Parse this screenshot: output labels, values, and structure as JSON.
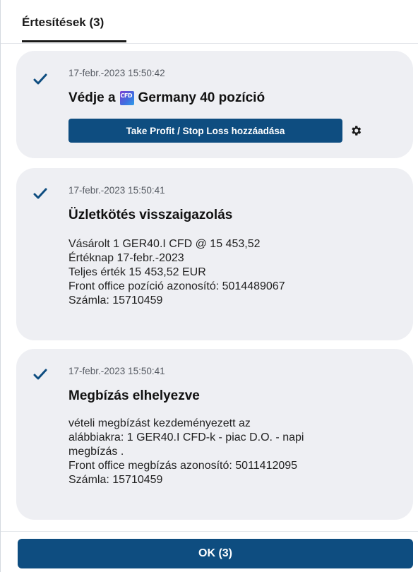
{
  "tabs": {
    "notifications_label": "Értesítések (3)"
  },
  "notifications": [
    {
      "timestamp": "17-febr.-2023 15:50:42",
      "title_prefix": "Védje a",
      "instrument_icon": "CFD",
      "title_suffix": "Germany 40 pozíció",
      "action_button": "Take Profit / Stop Loss hozzáadása",
      "settings_icon": "gear-icon"
    },
    {
      "timestamp": "17-febr.-2023 15:50:41",
      "title": "Üzletkötés visszaigazolás",
      "lines": [
        "Vásárolt 1 GER40.I CFD @ 15 453,52",
        "Értéknap 17-febr.-2023",
        "Teljes érték 15 453,52 EUR",
        "Front office pozíció azonosító: 5014489067",
        "Számla: 15710459"
      ]
    },
    {
      "timestamp": "17-febr.-2023 15:50:41",
      "title": "Megbízás elhelyezve",
      "lines": [
        "vételi megbízást kezdeményezett az",
        "alábbiakra: 1 GER40.I CFD-k - piac D.O. - napi",
        "megbízás .",
        "Front office megbízás azonosító: 5011412095",
        "Számla: 15710459"
      ]
    }
  ],
  "footer": {
    "ok_label": "OK (3)"
  },
  "colors": {
    "primary": "#0e4d80",
    "card_bg": "#eeeff3",
    "check": "#0e4d80"
  }
}
